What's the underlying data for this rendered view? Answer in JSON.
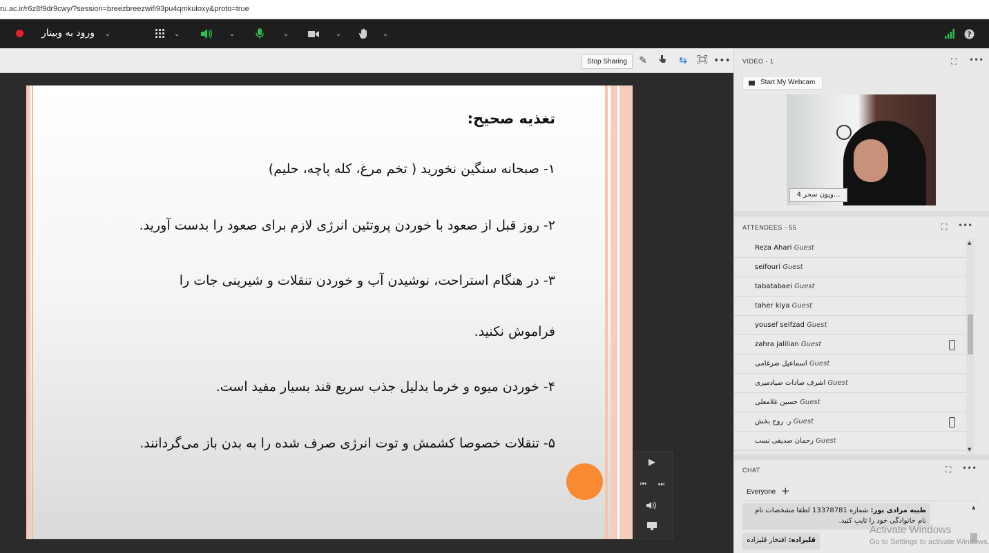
{
  "browser": {
    "url": "ru.ac.ir/r6z8f9dr9cwy/?session=breezbreezwifi93pu4qmkuloxy&proto=true"
  },
  "toolbar": {
    "meeting_title": "ورود به وبینار",
    "record_color": "#e8202a",
    "icons": [
      "record-dot-icon",
      "apps-grid-icon",
      "speaker-icon",
      "microphone-icon",
      "camera-icon",
      "raise-hand-icon",
      "signal-bars-icon",
      "help-icon"
    ]
  },
  "share": {
    "stop_sharing_label": "Stop Sharing",
    "slide": {
      "title": "تغذیه صحیح:",
      "lines": [
        "۱- صبحانه سنگین نخورید ( تخم مرغ، کله پاچه، حلیم)",
        "۲- روز قبل از صعود با خوردن پروتئین انرژی لازم برای صعود را بدست آورید.",
        "۳- در هنگام استراحت، نوشیدن آب و خوردن تنقلات و شیرینی جات را",
        "فراموش نکنید.",
        "۴- خوردن میوه و خرما بدلیل جذب سریع قند بسیار مفید است.",
        "۵- تنقلات خصوصا کشمش و توت انرژی صرف شده را به بدن باز می‌گردانند."
      ]
    }
  },
  "video_pod": {
    "title": "VIDEO",
    "count": "- 1",
    "webcam_label": "Start My Webcam",
    "name_tag": "...ویون سحر 4"
  },
  "attendees_pod": {
    "title": "ATTENDEES",
    "count": "- 55",
    "rows": [
      {
        "name": "Reza Ahari",
        "role": "Guest",
        "phone": false
      },
      {
        "name": "seifouri",
        "role": "Guest",
        "phone": false
      },
      {
        "name": "tabatabaei",
        "role": "Guest",
        "phone": false
      },
      {
        "name": "taher kiya",
        "role": "Guest",
        "phone": false
      },
      {
        "name": "yousef seifzad",
        "role": "Guest",
        "phone": false
      },
      {
        "name": "zahra jalilian",
        "role": "Guest",
        "phone": true
      },
      {
        "name": "اسماعیل ضرغامی",
        "role": "Guest",
        "phone": false
      },
      {
        "name": "اشرف صادات صیادمیری",
        "role": "Guest",
        "phone": false
      },
      {
        "name": "حسین غلامعلی",
        "role": "Guest",
        "phone": false
      },
      {
        "name": "ر. روح بخش",
        "role": "Guest",
        "phone": true
      },
      {
        "name": "رحمان صدیقی نسب",
        "role": "Guest",
        "phone": false
      }
    ]
  },
  "chat_pod": {
    "title": "CHAT",
    "tab_label": "Everyone",
    "messages": [
      {
        "sender": "طیبه مرادی پور:",
        "text": "شماره 13378781 لطفا مشخصات  نام نام خانوادگی خود را تایپ کنید."
      },
      {
        "sender": "قلیزاده:",
        "text": "افتخار قلیزاده"
      }
    ]
  },
  "watermark": {
    "line1": "Activate Windows",
    "line2": "Go to Settings to activate Windows."
  }
}
